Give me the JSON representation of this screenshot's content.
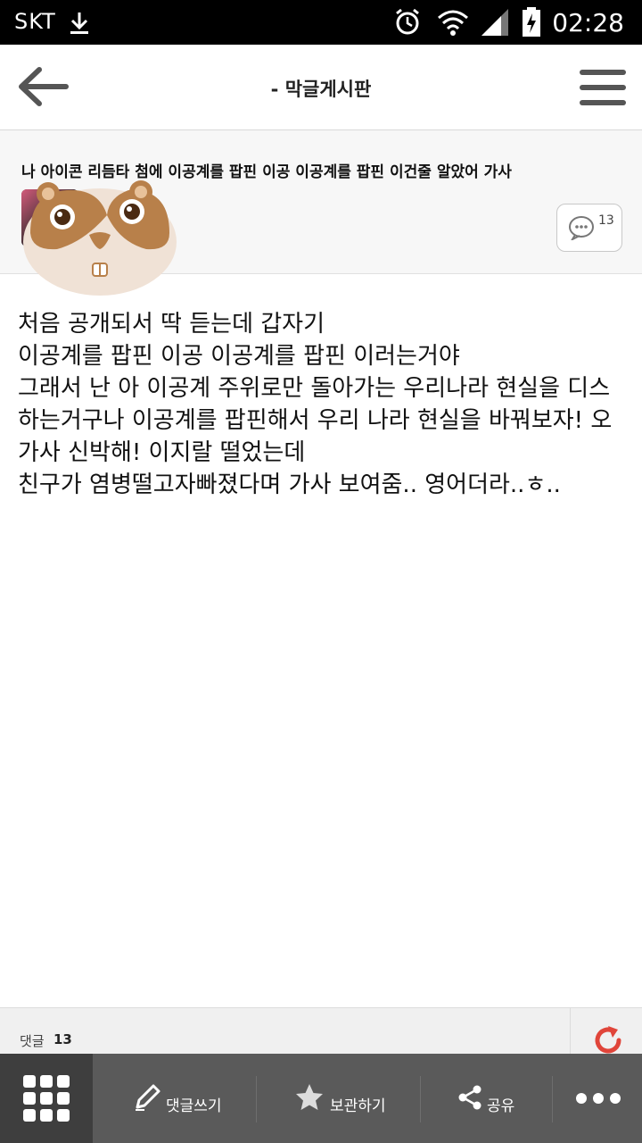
{
  "status_bar": {
    "carrier": "SKT",
    "time": "02:28"
  },
  "app_bar": {
    "title": "-  막글게시판"
  },
  "post": {
    "title": "나 아이콘 리듬타 첨에 이공계를 팝핀 이공 이공계를 팝핀 이건줄 알았어 가사",
    "comment_count": "13",
    "body_lines": [
      "처음 공개되서 딱 듣는데 갑자기",
      "이공계를 팝핀 이공 이공계를 팝핀 이러는거야",
      "그래서 난 아 이공계 주위로만 돌아가는 우리나라 현실을 디스",
      "하는거구나 이공계를 팝핀해서 우리 나라 현실을 바꿔보자! 오",
      "가사 신박해! 이지랄 떨었는데",
      "친구가 염병떨고자빠졌다며 가사 보여줌.. 영어더라..ㅎ.."
    ]
  },
  "footer": {
    "comments_label": "댓글",
    "comments_count": "13"
  },
  "bottom_bar": {
    "write_comment": "댓글쓰기",
    "bookmark": "보관하기",
    "share": "공유"
  },
  "colors": {
    "status_bg": "#000000",
    "bottom_bar_bg": "#5a5a5a",
    "refresh_accent": "#e0453a"
  },
  "icons": [
    "download-icon",
    "alarm-icon",
    "wifi-icon",
    "signal-icon",
    "battery-icon",
    "back-arrow-icon",
    "hamburger-menu-icon",
    "speech-bubble-icon",
    "refresh-icon",
    "grid-icon",
    "pencil-icon",
    "star-icon",
    "share-icon",
    "more-dots-icon"
  ]
}
